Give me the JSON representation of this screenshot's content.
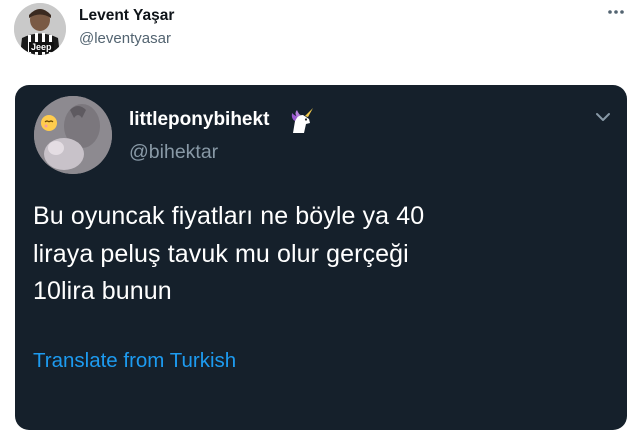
{
  "outer_tweet": {
    "display_name": "Levent Yaşar",
    "handle": "@leventyasar",
    "avatar_badge_text": "Jeep",
    "more_icon": "more-horizontal-icon"
  },
  "quoted_tweet": {
    "display_name": "littleponybihekt",
    "name_emoji_icon": "unicorn-icon",
    "handle": "@bihektar",
    "text_lines": [
      "Bu oyuncak fiyatları ne böyle ya 40",
      "liraya peluş tavuk mu olur gerçeği",
      "10lira bunun"
    ],
    "translate_label": "Translate from Turkish",
    "chevron_icon": "chevron-down-icon",
    "colors": {
      "background": "#15202b",
      "link": "#1d9bf0",
      "secondary_text": "#8899a6"
    }
  }
}
